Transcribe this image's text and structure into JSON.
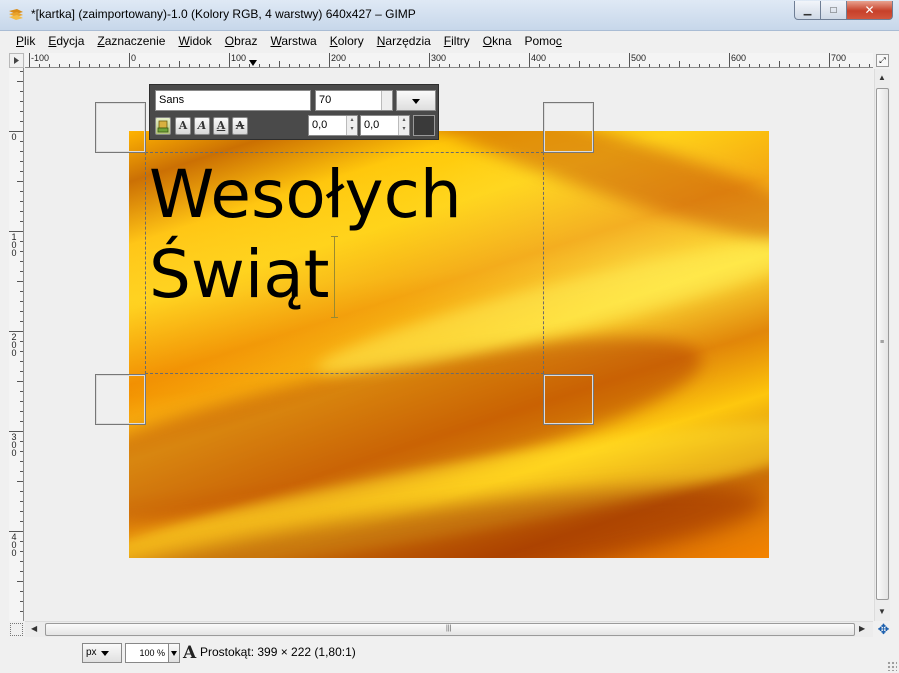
{
  "window": {
    "title": "*[kartka] (zaimportowany)-1.0 (Kolory RGB, 4 warstwy) 640x427 – GIMP",
    "minimize": "▁",
    "maximize": "□",
    "close": "✕"
  },
  "menu": [
    {
      "u": "P",
      "rest": "lik"
    },
    {
      "u": "E",
      "rest": "dycja"
    },
    {
      "u": "Z",
      "rest": "aznaczenie"
    },
    {
      "u": "W",
      "rest": "idok"
    },
    {
      "u": "O",
      "rest": "braz"
    },
    {
      "u": "W",
      "rest": "arstwa"
    },
    {
      "u": "K",
      "rest": "olory"
    },
    {
      "u": "N",
      "rest": "arzędzia"
    },
    {
      "u": "F",
      "rest": "iltry"
    },
    {
      "u": "O",
      "rest": "kna"
    },
    {
      "u": "Pomo",
      "rest": "c",
      "underline_last": true
    }
  ],
  "ruler": {
    "h_labels": [
      "-100",
      "0",
      "100",
      "200",
      "300",
      "400",
      "500",
      "600",
      "700"
    ],
    "v_labels": [
      "0",
      "100",
      "200",
      "300",
      "400"
    ]
  },
  "canvas": {
    "text_line1": "Wesołych",
    "text_line2": "Świąt"
  },
  "text_toolbox": {
    "font": "Sans",
    "size": "70",
    "baseline_offset": "0,0",
    "kerning": "0,0",
    "style_buttons": [
      "A",
      "A",
      "A",
      "A"
    ]
  },
  "status": {
    "unit": "px",
    "zoom": "100 %",
    "message": "Prostokąt: 399 × 222  (1,80:1)"
  }
}
